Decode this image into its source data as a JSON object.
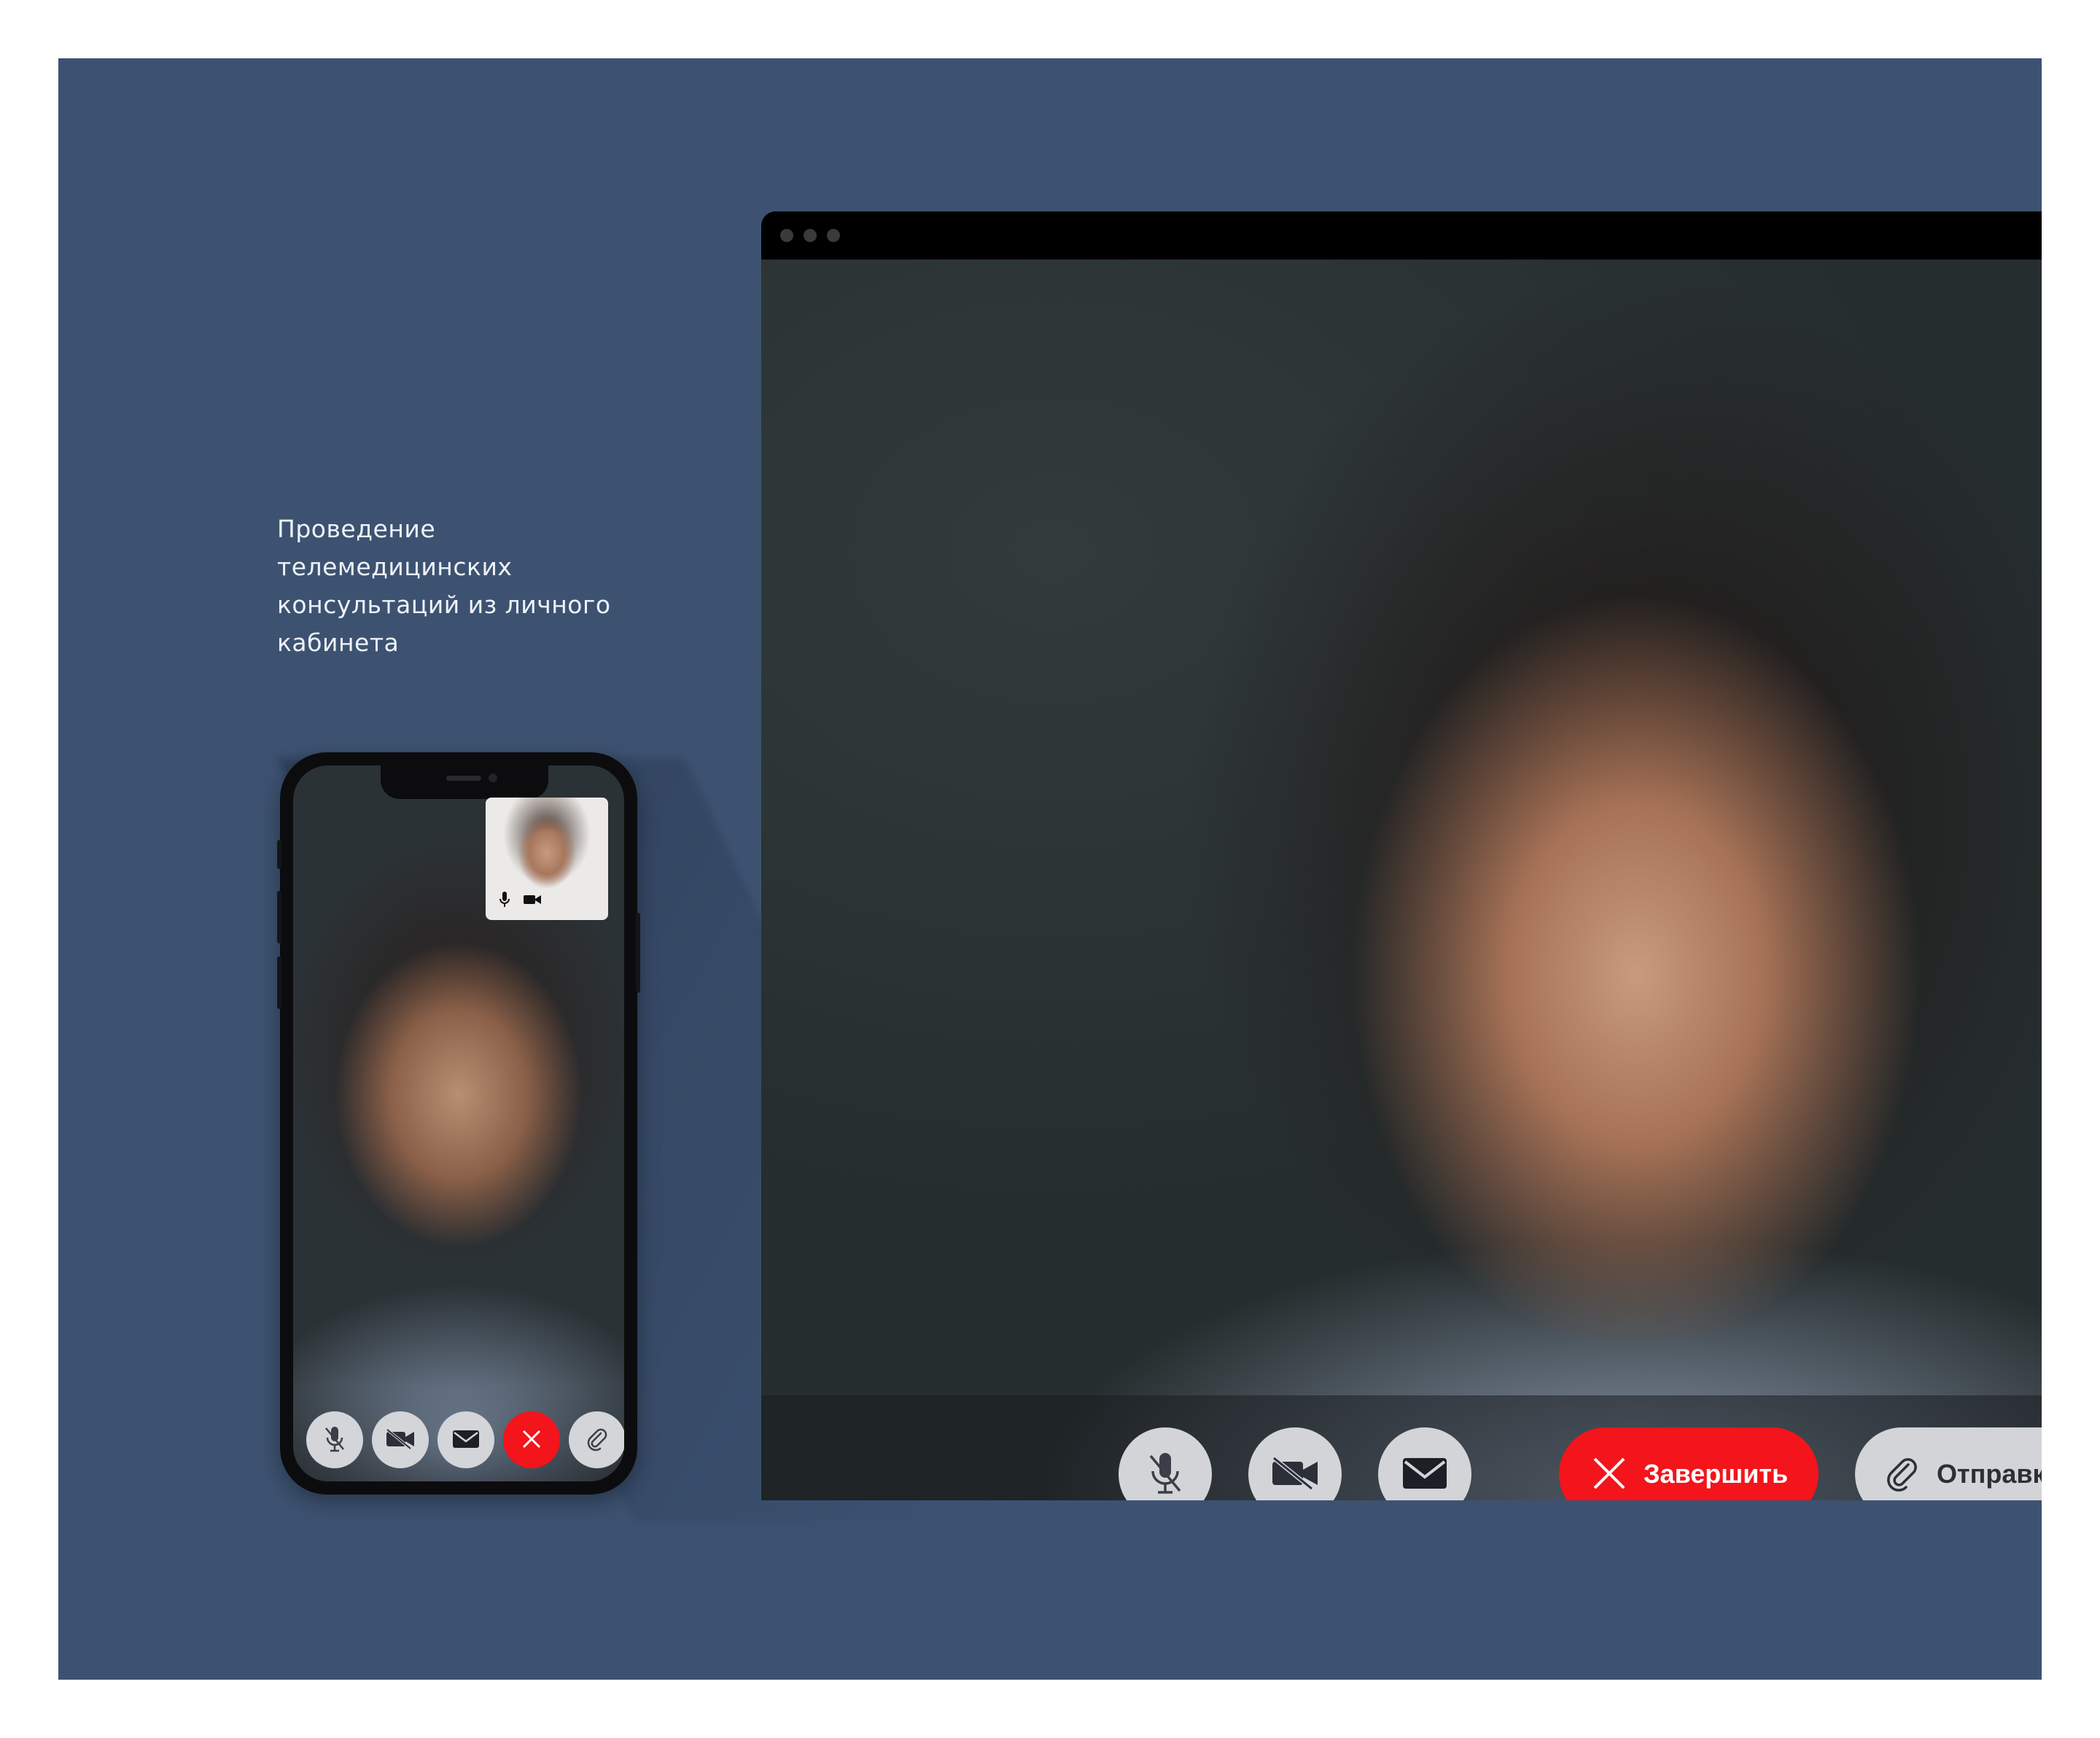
{
  "caption": {
    "lines": [
      "Проведение",
      "телемедицинских",
      "консультаций из личного",
      "кабинета"
    ]
  },
  "colors": {
    "background": "#3d5271",
    "end_call": "#f4141b",
    "control": "#d2d4d8"
  },
  "browser": {
    "controls": {
      "end_call_label": "Завершить",
      "send_file_label": "Отправка фай",
      "buttons": [
        "mic-off-icon",
        "video-off-icon",
        "mail-icon",
        "close-icon",
        "paperclip-icon"
      ]
    }
  },
  "phone": {
    "controls": [
      "mic-off-icon",
      "video-off-icon",
      "mail-icon",
      "close-icon",
      "paperclip-icon"
    ],
    "pip_controls": [
      "mic-icon",
      "video-icon"
    ]
  }
}
